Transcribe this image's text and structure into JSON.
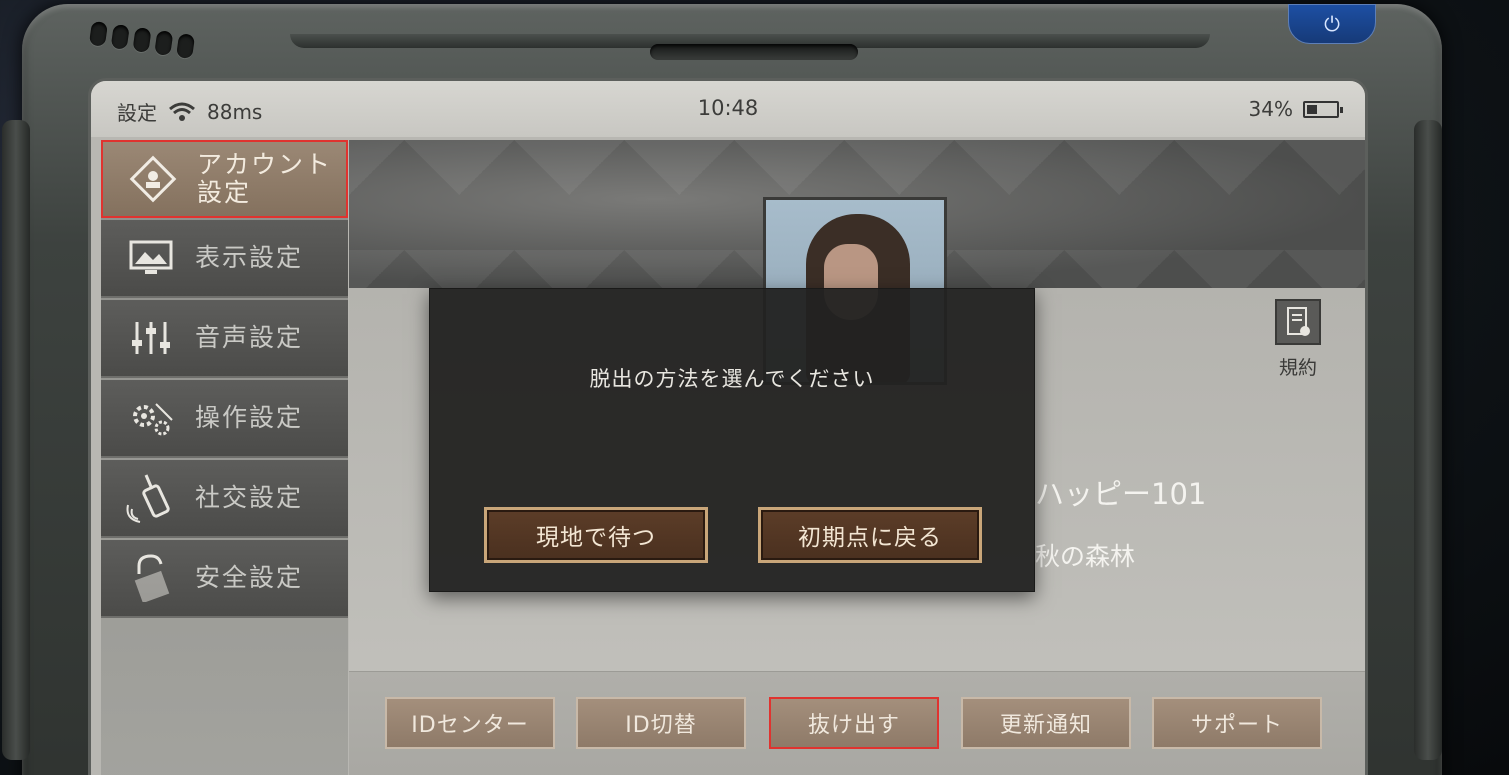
{
  "status_bar": {
    "settings_label": "設定",
    "ping": "88ms",
    "time": "10:48",
    "battery_percent": "34%",
    "battery_level": 0.34
  },
  "sidebar": {
    "items": [
      {
        "label_line1": "アカウント",
        "label_line2": "設定",
        "icon": "account-card-icon",
        "active": true
      },
      {
        "label": "表示設定",
        "icon": "display-icon",
        "active": false
      },
      {
        "label": "音声設定",
        "icon": "sliders-icon",
        "active": false
      },
      {
        "label": "操作設定",
        "icon": "gears-icon",
        "active": false
      },
      {
        "label": "社交設定",
        "icon": "walkie-talkie-icon",
        "active": false
      },
      {
        "label": "安全設定",
        "icon": "lock-icon",
        "active": false
      }
    ]
  },
  "profile": {
    "name_partial": "ハッピー101",
    "location_partial": "秋の森林",
    "terms_label": "規約"
  },
  "dialog": {
    "title": "脱出の方法を選んでください",
    "option_wait": "現地で待つ",
    "option_return": "初期点に戻る"
  },
  "bottom_buttons": [
    {
      "label": "IDセンター",
      "highlight": false
    },
    {
      "label": "ID切替",
      "highlight": false
    },
    {
      "label": "抜け出す",
      "highlight": true
    },
    {
      "label": "更新通知",
      "highlight": false
    },
    {
      "label": "サポート",
      "highlight": false
    }
  ],
  "colors": {
    "highlight_border": "#e0332f",
    "active_menu": "#84715e",
    "dialog_button": "#4a301f",
    "power_button": "#1d4fa3"
  }
}
